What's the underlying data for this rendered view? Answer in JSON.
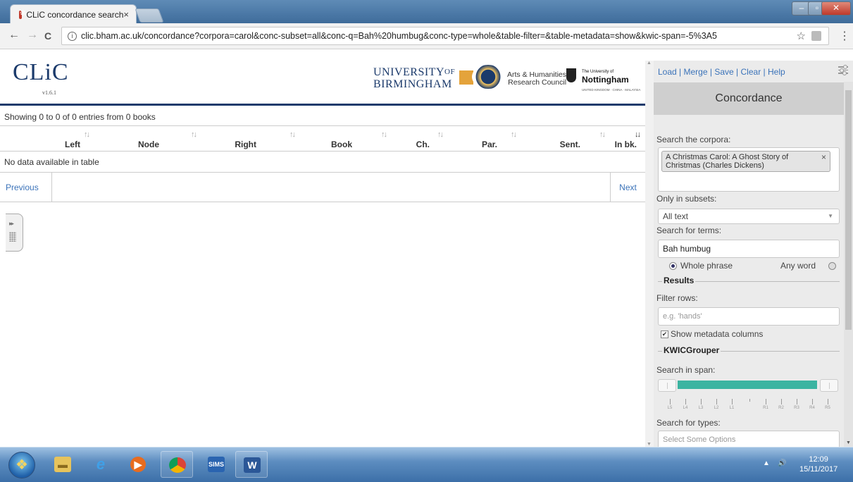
{
  "browser": {
    "tab_title": "CLiC concordance search",
    "tab_close": "×",
    "url": "clic.bham.ac.uk/concordance?corpora=carol&conc-subset=all&conc-q=Bah%20humbug&conc-type=whole&table-filter=&table-metadata=show&kwic-span=-5%3A5",
    "back": "←",
    "forward": "→",
    "reload": "C",
    "star": "☆",
    "menu": "⋮"
  },
  "header": {
    "logo": "CLiC",
    "version": "v1.6.1",
    "uob_line1": "UNIVERSITY",
    "uob_of": "OF",
    "uob_line2": "BIRMINGHAM",
    "ahrc_line1": "Arts & Humanities",
    "ahrc_line2": "Research Council",
    "notts_small": "The University of",
    "notts_name": "Nottingham",
    "notts_tag": "UNITED KINGDOM · CHINA · MALAYSIA"
  },
  "table": {
    "info": "Showing 0 to 0 of 0 entries from 0 books",
    "columns": [
      "Left",
      "Node",
      "Right",
      "Book",
      "Ch.",
      "Par.",
      "Sent.",
      "In bk."
    ],
    "empty": "No data available in table",
    "previous": "Previous",
    "next": "Next"
  },
  "sidebar": {
    "nav": [
      "Load",
      "Merge",
      "Save",
      "Clear",
      "Help"
    ],
    "heading": "Concordance",
    "search_corpora_label": "Search the corpora:",
    "corpus_chip": "A Christmas Carol: A Ghost Story of Christmas (Charles Dickens)",
    "chip_remove": "×",
    "subsets_label": "Only in subsets:",
    "subset_value": "All text",
    "terms_label": "Search for terms:",
    "terms_value": "Bah humbug",
    "whole_phrase": "Whole phrase",
    "any_word": "Any word",
    "results_legend": "Results",
    "filter_label": "Filter rows:",
    "filter_placeholder": "e.g. 'hands'",
    "show_metadata": "Show metadata columns",
    "kwic_legend": "KWICGrouper",
    "span_label": "Search in span:",
    "span_ticks": [
      "L5",
      "L4",
      "L3",
      "L2",
      "L1",
      "",
      "R1",
      "R2",
      "R3",
      "R4",
      "R5"
    ],
    "types_label": "Search for types:",
    "types_placeholder": "Select Some Options"
  },
  "taskbar": {
    "sims_label": "SIMS",
    "word_label": "W",
    "time": "12:09",
    "date": "15/11/2017"
  }
}
